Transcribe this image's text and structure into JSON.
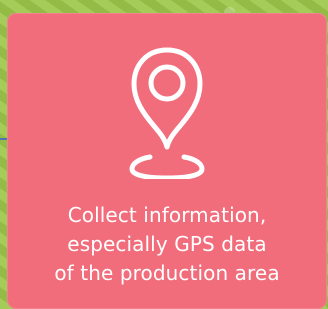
{
  "card": {
    "icon": "map-pin-icon",
    "caption_lines": [
      "Collect information,",
      "especially GPS data",
      "of the production area"
    ]
  },
  "colors": {
    "card_background": "#f16d7c",
    "background": "#9cc24f",
    "text": "#ffffff"
  }
}
